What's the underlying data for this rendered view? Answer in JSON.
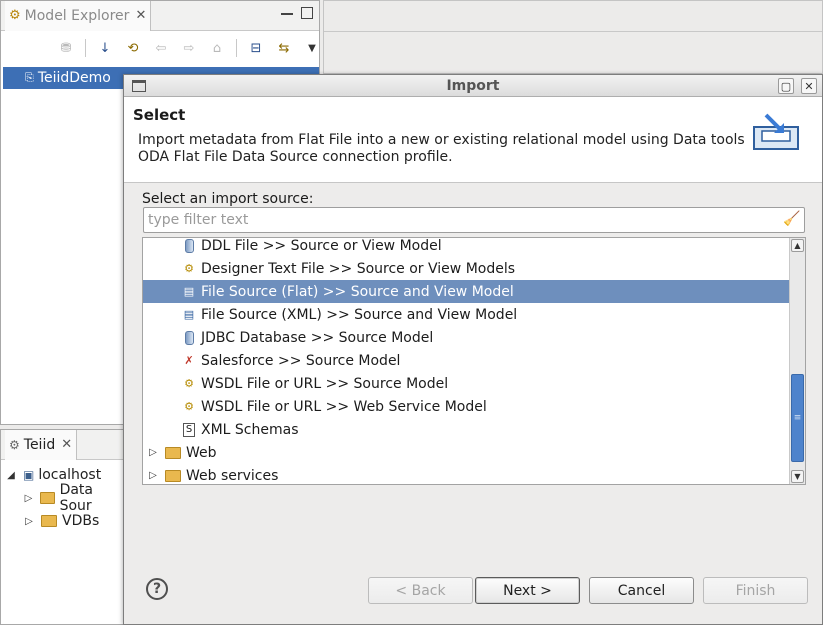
{
  "workbench": {
    "model_explorer": {
      "tab_label": "Model Explorer",
      "project": "TeiidDemo"
    },
    "teiid_view": {
      "tab_label": "Teiid",
      "server": "localhost",
      "children": [
        "Data Sour",
        "VDBs"
      ]
    }
  },
  "dialog": {
    "title": "Import",
    "header_title": "Select",
    "description": "Import metadata from Flat File into a new or existing relational model using Data tools ODA Flat File Data Source connection profile.",
    "source_label": "Select an import source:",
    "filter_placeholder": "type filter text",
    "filter_value": "",
    "items": [
      {
        "label": "DDL File >> Source or View Model",
        "icon": "database-icon",
        "selected": false
      },
      {
        "label": "Designer Text File >> Source or View Models",
        "icon": "gear-file-icon",
        "selected": false
      },
      {
        "label": "File Source (Flat) >> Source and View Model",
        "icon": "flat-file-icon",
        "selected": true
      },
      {
        "label": "File Source (XML) >> Source and View Model",
        "icon": "xml-file-icon",
        "selected": false
      },
      {
        "label": "JDBC Database >> Source Model",
        "icon": "database-icon",
        "selected": false
      },
      {
        "label": "Salesforce >> Source Model",
        "icon": "salesforce-icon",
        "selected": false
      },
      {
        "label": "WSDL File or URL >> Source Model",
        "icon": "gear-file-icon",
        "selected": false
      },
      {
        "label": "WSDL File or URL >> Web Service Model",
        "icon": "gear-file-icon",
        "selected": false
      },
      {
        "label": "XML Schemas",
        "icon": "schema-icon",
        "selected": false
      }
    ],
    "categories": [
      {
        "label": "Web",
        "icon": "folder-icon"
      },
      {
        "label": "Web services",
        "icon": "folder-icon"
      }
    ],
    "buttons": {
      "help": "?",
      "back": "< Back",
      "next": "Next >",
      "cancel": "Cancel",
      "finish": "Finish"
    }
  },
  "colors": {
    "selection": "#6e8fbd",
    "scroll_thumb": "#4e83cc"
  }
}
